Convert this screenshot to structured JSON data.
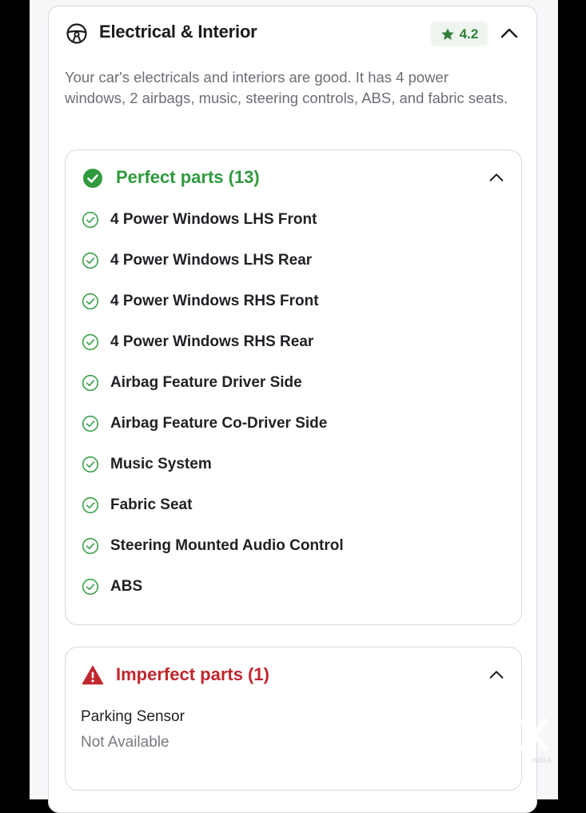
{
  "header": {
    "title": "Electrical & Interior",
    "rating": "4.2",
    "icon": "steering-wheel-icon"
  },
  "description": "Your car's electricals and interiors are good. It has 4 power windows, 2 airbags, music, steering controls, ABS, and fabric seats.",
  "perfect": {
    "title": "Perfect parts (13)",
    "items": [
      "4 Power Windows LHS Front",
      "4 Power Windows LHS Rear",
      "4 Power Windows RHS Front",
      "4 Power Windows RHS Rear",
      "Airbag Feature Driver Side",
      "Airbag Feature Co-Driver Side",
      "Music System",
      "Fabric Seat",
      "Steering Mounted Audio Control",
      "ABS"
    ]
  },
  "imperfect": {
    "title": "Imperfect parts (1)",
    "items": [
      {
        "label": "Parking Sensor",
        "value": "Not Available"
      }
    ]
  },
  "watermark": {
    "brand": "OLX",
    "region": "INDIA"
  },
  "colors": {
    "good": "#2f9a3d",
    "bad": "#c0272d",
    "rating_bg": "#eef5ee",
    "rating_text": "#2f7f3b"
  }
}
